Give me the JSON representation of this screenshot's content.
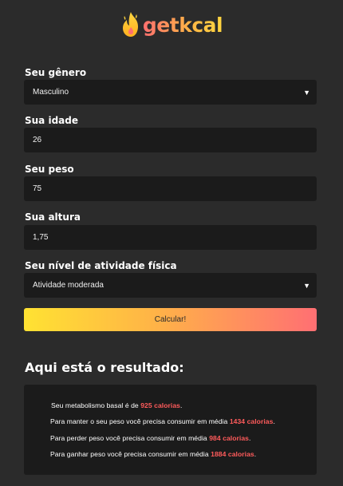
{
  "app": {
    "logo_text": "getkcal",
    "logo_icon": "flame-icon",
    "accent_gradient": [
      "#ffe232",
      "#ffb347",
      "#ff6f73"
    ]
  },
  "form": {
    "gender": {
      "label": "Seu gênero",
      "value": "Masculino"
    },
    "age": {
      "label": "Sua idade",
      "value": "26"
    },
    "weight": {
      "label": "Seu peso",
      "value": "75"
    },
    "height": {
      "label": "Sua altura",
      "value": "1,75"
    },
    "activity": {
      "label": "Seu nível de atividade física",
      "value": "Atividade moderada"
    },
    "submit_label": "Calcular!"
  },
  "result": {
    "title": "Aqui está o resultado:",
    "basal": {
      "prefix": "Seu metabolismo basal é de ",
      "value": "925 calorias",
      "suffix": "."
    },
    "maintain": {
      "prefix": "Para manter o seu peso você precisa consumir em média ",
      "value": "1434 calorias",
      "suffix": "."
    },
    "lose": {
      "prefix": "Para perder peso você precisa consumir em média ",
      "value": "984 calorias",
      "suffix": "."
    },
    "gain": {
      "prefix": "Para ganhar peso você precisa consumir em média ",
      "value": "1884 calorias",
      "suffix": "."
    }
  }
}
